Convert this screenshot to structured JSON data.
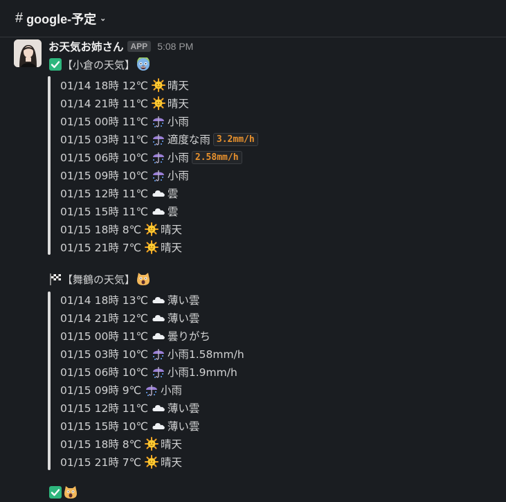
{
  "channel": {
    "hash": "#",
    "name": "google-予定"
  },
  "message": {
    "sender": "お天気お姉さん",
    "badge": "APP",
    "time": "5:08 PM"
  },
  "sections": [
    {
      "title": "【小倉の天気】",
      "lead_icon": "check-mark-icon",
      "tail_icon": "scared-face-icon",
      "rows": [
        {
          "dt": "01/14 18時 12℃",
          "icon": "sun",
          "cond": "晴天"
        },
        {
          "dt": "01/14 21時 11℃",
          "icon": "sun",
          "cond": "晴天"
        },
        {
          "dt": "01/15 00時 11℃",
          "icon": "umbrella",
          "cond": "小雨"
        },
        {
          "dt": "01/15 03時 11℃",
          "icon": "umbrella",
          "cond": "適度な雨",
          "code": "3.2mm/h"
        },
        {
          "dt": "01/15 06時 10℃",
          "icon": "umbrella",
          "cond": "小雨",
          "code": "2.58mm/h"
        },
        {
          "dt": "01/15 09時 10℃",
          "icon": "umbrella",
          "cond": "小雨"
        },
        {
          "dt": "01/15 12時 11℃",
          "icon": "cloud",
          "cond": "雲"
        },
        {
          "dt": "01/15 15時 11℃",
          "icon": "cloud",
          "cond": "雲"
        },
        {
          "dt": "01/15 18時 8℃",
          "icon": "sun",
          "cond": "晴天"
        },
        {
          "dt": "01/15 21時 7℃",
          "icon": "sun",
          "cond": "晴天"
        }
      ]
    },
    {
      "title": "【舞鶴の天気】",
      "lead_icon": "checkered-flag-icon",
      "tail_icon": "screaming-cat-icon",
      "rows": [
        {
          "dt": "01/14 18時 13℃",
          "icon": "cloud",
          "cond": "薄い雲"
        },
        {
          "dt": "01/14 21時 12℃",
          "icon": "cloud",
          "cond": "薄い雲"
        },
        {
          "dt": "01/15 00時 11℃",
          "icon": "cloud",
          "cond": "曇りがち"
        },
        {
          "dt": "01/15 03時 10℃",
          "icon": "umbrella",
          "cond": "小雨1.58mm/h"
        },
        {
          "dt": "01/15 06時 10℃",
          "icon": "umbrella",
          "cond": "小雨1.9mm/h"
        },
        {
          "dt": "01/15 09時 9℃",
          "icon": "umbrella",
          "cond": "小雨"
        },
        {
          "dt": "01/15 12時 11℃",
          "icon": "cloud",
          "cond": "薄い雲"
        },
        {
          "dt": "01/15 15時 10℃",
          "icon": "cloud",
          "cond": "薄い雲"
        },
        {
          "dt": "01/15 18時 8℃",
          "icon": "sun",
          "cond": "晴天"
        },
        {
          "dt": "01/15 21時 7℃",
          "icon": "sun",
          "cond": "晴天"
        }
      ]
    },
    {
      "title": "",
      "lead_icon": "check-mark-icon",
      "tail_icon": "screaming-cat-icon",
      "rows": []
    }
  ],
  "colors": {
    "background": "#1a1d21",
    "text": "#d1d2d3",
    "code": "#e8912d",
    "check": "#2eb67d"
  }
}
